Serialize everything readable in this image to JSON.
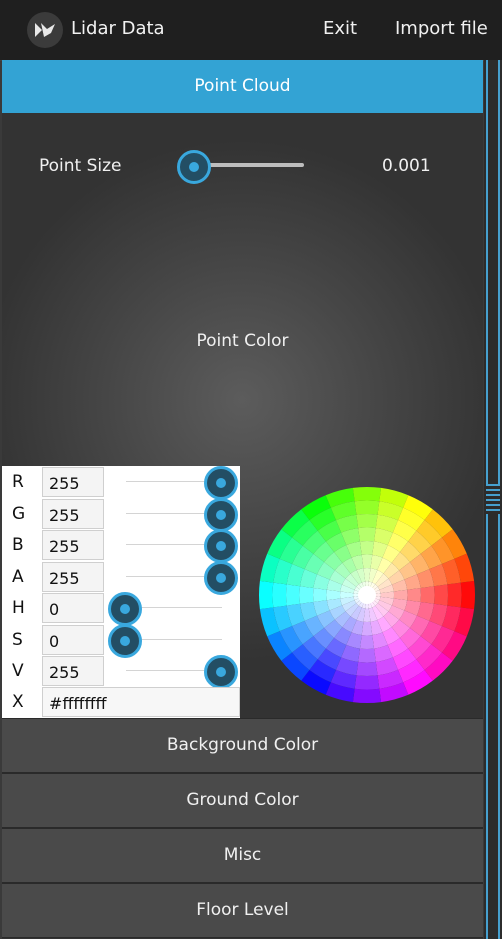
{
  "app": {
    "title": "Lidar Data",
    "exit_label": "Exit",
    "import_label": "Import file"
  },
  "sections": {
    "point_cloud": "Point Cloud",
    "background_color": "Background Color",
    "ground_color": "Ground Color",
    "misc": "Misc",
    "floor_level": "Floor Level"
  },
  "point_size": {
    "label": "Point Size",
    "value": "0.001",
    "slider_fraction": 0.0
  },
  "point_color": {
    "label": "Point Color",
    "channels": [
      {
        "letter": "R",
        "value": "255",
        "fraction": 1.0
      },
      {
        "letter": "G",
        "value": "255",
        "fraction": 1.0
      },
      {
        "letter": "B",
        "value": "255",
        "fraction": 1.0
      },
      {
        "letter": "A",
        "value": "255",
        "fraction": 1.0
      },
      {
        "letter": "H",
        "value": "0",
        "fraction": 0.0
      },
      {
        "letter": "S",
        "value": "0",
        "fraction": 0.0
      },
      {
        "letter": "V",
        "value": "255",
        "fraction": 1.0
      }
    ],
    "hex_letter": "X",
    "hex_value": "#ffffffff"
  },
  "colors": {
    "accent": "#33a3d4",
    "topbar": "#1f1f1f",
    "panel": "#454545"
  }
}
